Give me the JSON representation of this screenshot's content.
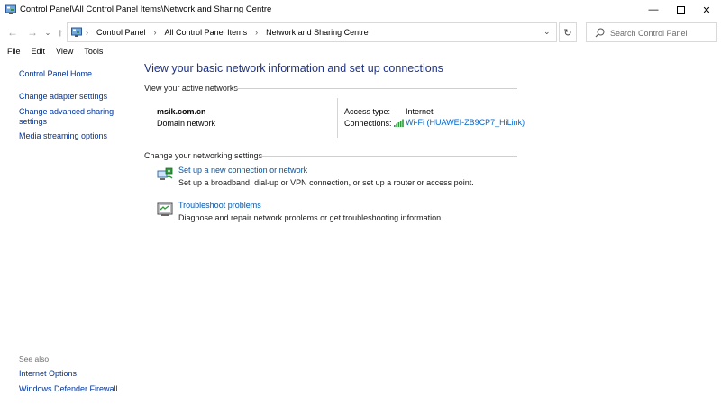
{
  "window": {
    "title": "Control Panel\\All Control Panel Items\\Network and Sharing Centre",
    "minimize_glyph": "—",
    "close_glyph": "✕"
  },
  "address_bar": {
    "breadcrumbs": [
      "Control Panel",
      "All Control Panel Items",
      "Network and Sharing Centre"
    ],
    "separator": "›",
    "dropdown_glyph": "⌄",
    "refresh_glyph": "↻"
  },
  "search": {
    "placeholder": "Search Control Panel"
  },
  "nav": {
    "back_glyph": "←",
    "forward_glyph": "→",
    "recent_glyph": "⌄",
    "up_glyph": "↑"
  },
  "menu": [
    "File",
    "Edit",
    "View",
    "Tools"
  ],
  "sidebar": {
    "home": "Control Panel Home",
    "items": [
      "Change adapter settings",
      "Change advanced sharing settings",
      "Media streaming options"
    ],
    "see_also_label": "See also",
    "see_also": [
      "Internet Options",
      "Windows Defender Firewall"
    ]
  },
  "main": {
    "title": "View your basic network information and set up connections",
    "active_networks_heading": "View your active networks",
    "network": {
      "name": "msik.com.cn",
      "type": "Domain network",
      "access_type_label": "Access type:",
      "access_type": "Internet",
      "connections_label": "Connections:",
      "connection": "Wi-Fi (HUAWEI-ZB9CP7_HiLink)"
    },
    "change_settings_heading": "Change your networking settings",
    "tasks": [
      {
        "link": "Set up a new connection or network",
        "desc": "Set up a broadband, dial-up or VPN connection, or set up a router or access point.",
        "icon": "new-connection-icon"
      },
      {
        "link": "Troubleshoot problems",
        "desc": "Diagnose and repair network problems or get troubleshooting information.",
        "icon": "troubleshoot-icon"
      }
    ]
  },
  "colors": {
    "title_blue": "#1e3287",
    "link_blue": "#0055aa",
    "sidebar_link": "#003399",
    "wifi_green": "#2e9a3b"
  }
}
